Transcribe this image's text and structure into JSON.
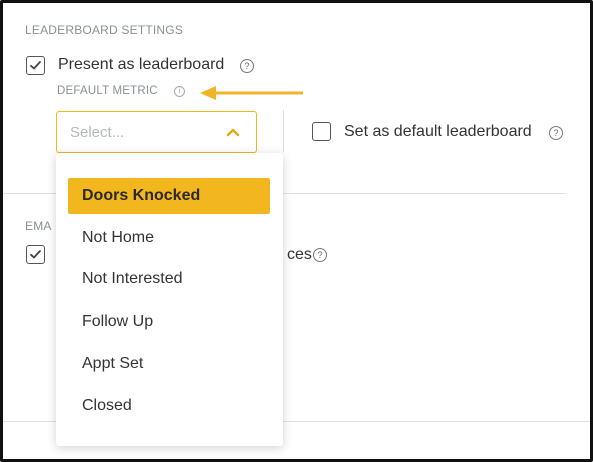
{
  "leaderboard_settings": {
    "section_title": "LEADERBOARD SETTINGS",
    "present_as_leaderboard": {
      "label": "Present as leaderboard",
      "checked": true
    },
    "default_metric_label": "DEFAULT METRIC",
    "select": {
      "placeholder": "Select..."
    },
    "set_as_default": {
      "label": "Set as default leaderboard",
      "checked": false
    }
  },
  "email_section": {
    "title_visible": "EMA",
    "checkbox_checked": true,
    "label_visible_suffix": "ces"
  },
  "dropdown": {
    "options": [
      "Doors Knocked",
      "Not Home",
      "Not Interested",
      "Follow Up",
      "Appt Set",
      "Closed"
    ],
    "selected_index": 0
  },
  "colors": {
    "accent": "#f2b71f",
    "annotation_arrow": "#f0b429",
    "muted_text": "#8a8f96",
    "text": "#333333"
  },
  "icons": {
    "help": "question-circle-icon",
    "info": "info-circle-icon",
    "chevron": "chevron-up-icon",
    "check": "check-icon",
    "arrow": "left-arrow-annotation"
  }
}
